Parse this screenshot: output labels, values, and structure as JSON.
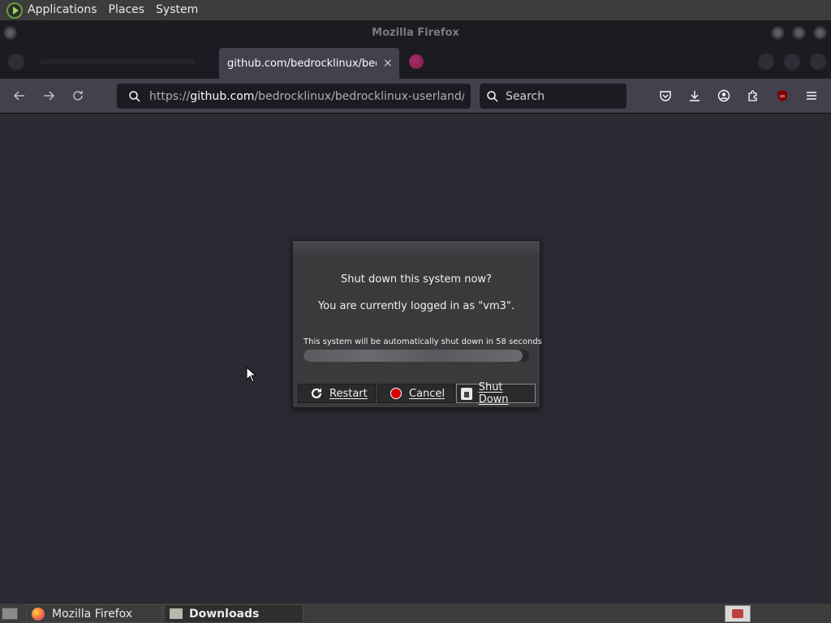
{
  "top_panel": {
    "menus": [
      "Applications",
      "Places",
      "System"
    ],
    "logo_icon": "mate-menu-icon"
  },
  "window": {
    "title": "Mozilla Firefox"
  },
  "tabs": {
    "active_label": "github.com/bedrocklinux/bedrocklinux-userland/releases",
    "close_icon": "×"
  },
  "navbar": {
    "url_prefix": "https://",
    "url_domain": "github.com",
    "url_path": "/bedrocklinux/bedrocklinux-userland/releases",
    "search_placeholder": "Search",
    "icons": [
      "back-icon",
      "forward-icon",
      "reload-icon",
      "pocket-icon",
      "downloads-icon",
      "account-icon",
      "extensions-icon",
      "ublock-icon",
      "menu-icon"
    ]
  },
  "dialog": {
    "question": "Shut down this system now?",
    "login_text": "You are currently logged in as \"vm3\".",
    "countdown_text": "This system will be automatically shut down in 58 seconds",
    "progress_fraction": 0.97,
    "buttons": {
      "restart": "Restart",
      "cancel": "Cancel",
      "shutdown": "Shut Down"
    }
  },
  "bottom_panel": {
    "tasks": [
      {
        "label": "Mozilla Firefox",
        "icon": "firefox-icon"
      },
      {
        "label": "Downloads",
        "icon": "folder-icon"
      }
    ]
  },
  "colors": {
    "content_bg": "#2b2a33",
    "cancel_red": "#d40000"
  }
}
